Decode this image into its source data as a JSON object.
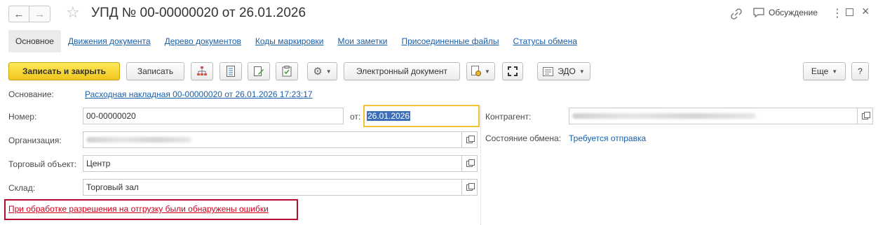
{
  "header": {
    "back_icon": "arrow-left-icon",
    "forward_icon": "arrow-right-icon",
    "favorite_icon": "star-icon",
    "title": "УПД № 00-00000020 от 26.01.2026",
    "link_icon": "link-icon",
    "discussion_label": "Обсуждение",
    "more_icon": "more-vertical-icon",
    "maximize_icon": "maximize-icon",
    "close_icon": "close-icon"
  },
  "tabs": [
    {
      "label": "Основное",
      "active": true
    },
    {
      "label": "Движения документа"
    },
    {
      "label": "Дерево документов"
    },
    {
      "label": "Коды маркировки"
    },
    {
      "label": "Мои заметки"
    },
    {
      "label": "Присоединенные файлы"
    },
    {
      "label": "Статусы обмена"
    }
  ],
  "toolbar": {
    "save_close": "Записать и закрыть",
    "save": "Записать",
    "edoc": "Электронный документ",
    "edo": "ЭДО",
    "more": "Еще",
    "help": "?"
  },
  "form": {
    "basis_label": "Основание:",
    "basis_link": "Расходная накладная 00-00000020 от 26.01.2026 17:23:17",
    "number_label": "Номер:",
    "number_value": "00-00000020",
    "date_label": "от:",
    "date_value": "26.01.2026",
    "counterparty_label": "Контрагент:",
    "org_label": "Организация:",
    "exchange_state_label": "Состояние обмена:",
    "exchange_state_value": "Требуется отправка",
    "trade_object_label": "Торговый объект:",
    "trade_object_value": "Центр",
    "warehouse_label": "Склад:",
    "warehouse_value": "Торговый зал",
    "error_link": "При обработке разрешения на отгрузку были обнаружены ошибки"
  },
  "colors": {
    "accent_link": "#1a5fa8",
    "primary_button": "#f0c61d",
    "error": "#d0021b",
    "error_frame": "#b3102f",
    "focus": "#f1c232"
  }
}
